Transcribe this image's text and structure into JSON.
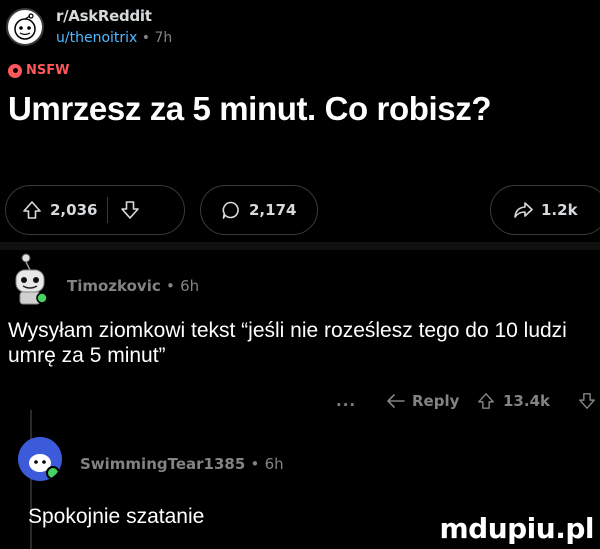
{
  "post": {
    "subreddit": "r/AskReddit",
    "author": "u/thenoitrix",
    "separator": "•",
    "age": "7h",
    "nsfw_label": "NSFW",
    "title": "Umrzesz za 5 minut. Co robisz?",
    "upvotes": "2,036",
    "comments": "2,174",
    "shares": "1.2k"
  },
  "comments": [
    {
      "author": "Timozkovic",
      "separator": "•",
      "age": "6h",
      "body": "Wysyłam ziomkowi tekst “jeśli nie roześlesz tego do 10 ludzi umrę za 5 minut”",
      "more": "...",
      "reply_label": "Reply",
      "score": "13.4k"
    },
    {
      "author": "SwimmingTear1385",
      "separator": "•",
      "age": "6h",
      "body": "Spokojnie szatanie"
    }
  ],
  "watermark": "mdupiu.pl",
  "colors": {
    "background": "#000000",
    "nsfw": "#ff585b",
    "username_link": "#4fbcff",
    "meta": "#818384"
  }
}
